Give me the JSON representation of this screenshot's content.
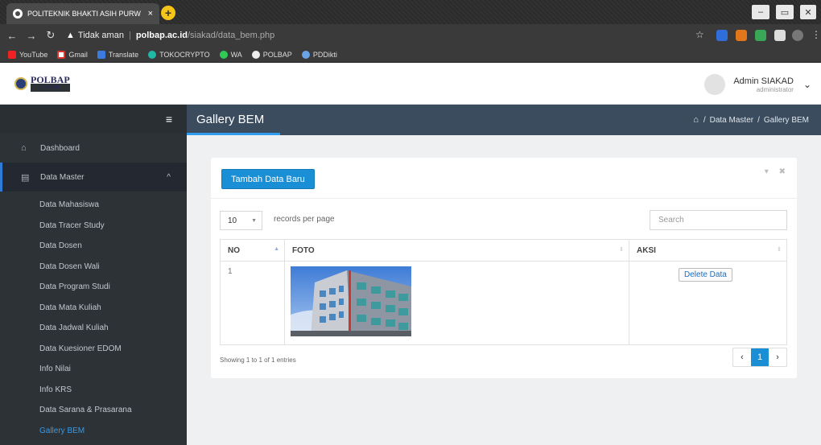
{
  "browser": {
    "tab_title": "POLITEKNIK BHAKTI ASIH PURW",
    "tab_close": "×",
    "new_tab": "+",
    "security_label": "Tidak aman",
    "url_host": "polbap.ac.id",
    "url_path": "/siakad/data_bem.php",
    "bookmarks": [
      "YouTube",
      "Gmail",
      "Translate",
      "TOKOCRYPTO",
      "WA",
      "POLBAP",
      "PDDikti"
    ]
  },
  "header": {
    "logo_text": "POLBAP",
    "logo_sub": "SIAKAD",
    "user_name": "Admin SIAKAD",
    "user_role": "administrator"
  },
  "sidebar": {
    "items": [
      {
        "label": "Dashboard",
        "icon": "home-icon"
      },
      {
        "label": "Data Master",
        "icon": "list-icon"
      }
    ],
    "sub_items": [
      "Data Mahasiswa",
      "Data Tracer Study",
      "Data Dosen",
      "Data Dosen Wali",
      "Data Program Studi",
      "Data Mata Kuliah",
      "Data Jadwal Kuliah",
      "Data Kuesioner EDOM",
      "Info Nilai",
      "Info KRS",
      "Data Sarana & Prasarana",
      "Gallery BEM"
    ]
  },
  "page": {
    "title": "Gallery BEM",
    "breadcrumb": [
      "Data Master",
      "Gallery BEM"
    ],
    "breadcrumb_sep": "/"
  },
  "panel": {
    "add_button": "Tambah Data Baru",
    "page_length": "10",
    "length_label": "records per page",
    "search_placeholder": "Search",
    "columns": [
      "NO",
      "FOTO",
      "AKSI"
    ],
    "rows": [
      {
        "no": "1",
        "action": "Delete Data"
      }
    ],
    "info": "Showing 1 to 1 of 1 entries",
    "pages": [
      "1"
    ]
  },
  "colors": {
    "accent": "#1a8fd6",
    "sidebar_bg": "#2d3237",
    "header_bg": "#3b4c5e"
  }
}
